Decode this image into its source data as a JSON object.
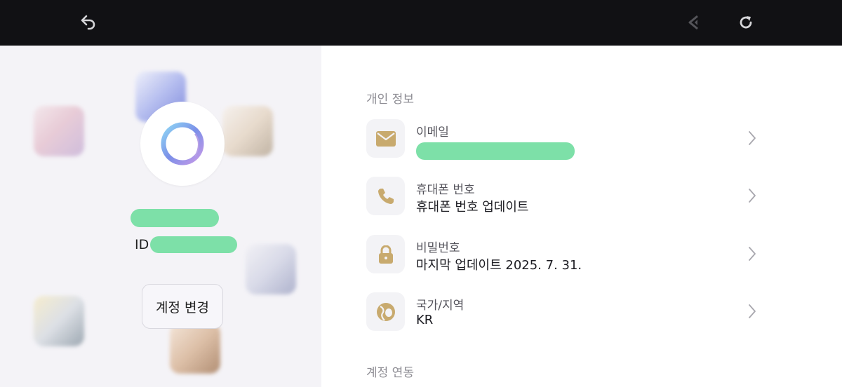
{
  "topbar": {
    "back_icon": "undo-arrow-icon",
    "share_icon": "share-arrow-icon",
    "refresh_icon": "refresh-icon"
  },
  "profile": {
    "id_label": "ID",
    "switch_button": "계정 변경"
  },
  "personal_info": {
    "section_title": "개인 정보",
    "rows": [
      {
        "label": "이메일",
        "value": "",
        "icon": "mail-icon"
      },
      {
        "label": "휴대폰 번호",
        "value": "휴대폰 번호 업데이트",
        "icon": "phone-icon"
      },
      {
        "label": "비밀번호",
        "value": "마지막 업데이트 2025. 7. 31.",
        "icon": "lock-icon"
      },
      {
        "label": "국가/지역",
        "value": "KR",
        "icon": "globe-icon"
      }
    ]
  },
  "account_link": {
    "section_title": "계정 연동"
  },
  "colors": {
    "topbar": "#111114",
    "left_panel": "#f4f3f7",
    "icon_gold": "#c8aa6e",
    "redaction": "#7de0a8"
  }
}
